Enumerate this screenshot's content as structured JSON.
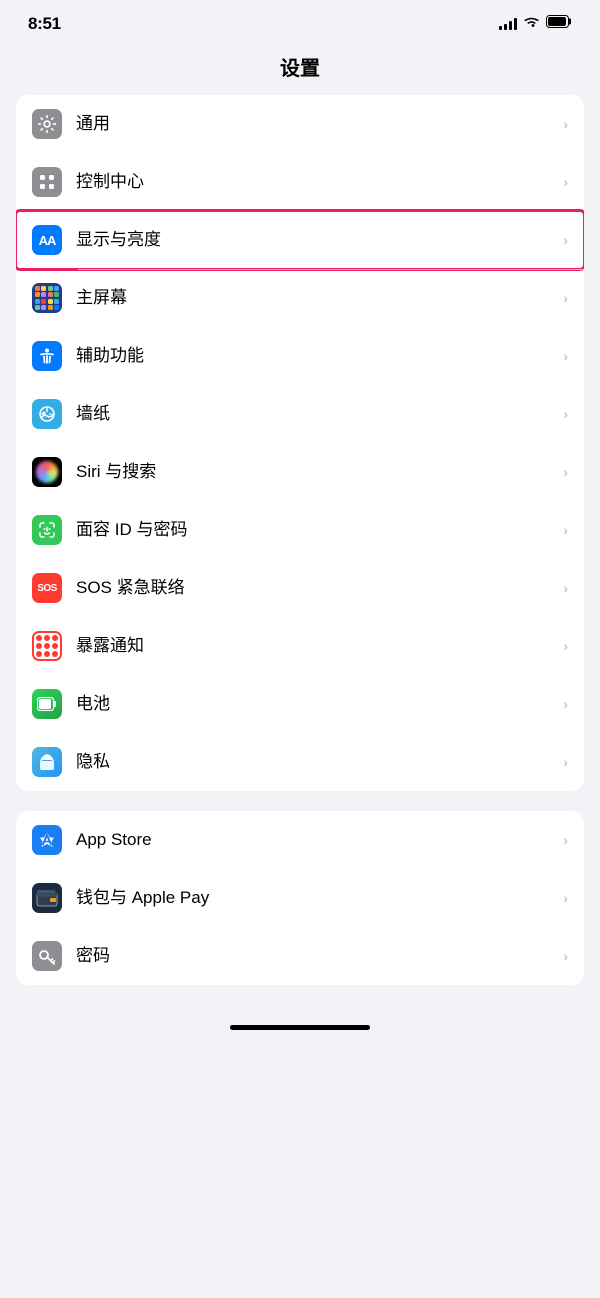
{
  "statusBar": {
    "time": "8:51"
  },
  "pageTitle": "设置",
  "group1": {
    "items": [
      {
        "id": "general",
        "label": "通用",
        "iconType": "gear",
        "iconBg": "gray",
        "highlighted": false
      },
      {
        "id": "control-center",
        "label": "控制中心",
        "iconType": "toggle",
        "iconBg": "gray",
        "highlighted": false
      },
      {
        "id": "display",
        "label": "显示与亮度",
        "iconType": "aa",
        "iconBg": "blue",
        "highlighted": true
      },
      {
        "id": "home-screen",
        "label": "主屏幕",
        "iconType": "grid",
        "iconBg": "dark-blue",
        "highlighted": false
      },
      {
        "id": "accessibility",
        "label": "辅助功能",
        "iconType": "accessibility",
        "iconBg": "blue",
        "highlighted": false
      },
      {
        "id": "wallpaper",
        "label": "墙纸",
        "iconType": "flower",
        "iconBg": "teal",
        "highlighted": false
      },
      {
        "id": "siri",
        "label": "Siri 与搜索",
        "iconType": "siri",
        "iconBg": "siri",
        "highlighted": false
      },
      {
        "id": "faceid",
        "label": "面容 ID 与密码",
        "iconType": "faceid",
        "iconBg": "green",
        "highlighted": false
      },
      {
        "id": "sos",
        "label": "SOS 紧急联络",
        "iconType": "sos",
        "iconBg": "red",
        "highlighted": false
      },
      {
        "id": "exposure",
        "label": "暴露通知",
        "iconType": "exposure",
        "iconBg": "exposure",
        "highlighted": false
      },
      {
        "id": "battery",
        "label": "电池",
        "iconType": "battery",
        "iconBg": "green",
        "highlighted": false
      },
      {
        "id": "privacy",
        "label": "隐私",
        "iconType": "hand",
        "iconBg": "light-blue",
        "highlighted": false
      }
    ]
  },
  "group2": {
    "items": [
      {
        "id": "appstore",
        "label": "App Store",
        "iconType": "appstore",
        "iconBg": "blue",
        "highlighted": false
      },
      {
        "id": "wallet",
        "label": "钱包与 Apple Pay",
        "iconType": "wallet",
        "iconBg": "dark",
        "highlighted": false
      },
      {
        "id": "passwords",
        "label": "密码",
        "iconType": "key",
        "iconBg": "gray",
        "highlighted": false
      }
    ]
  },
  "chevron": "›"
}
